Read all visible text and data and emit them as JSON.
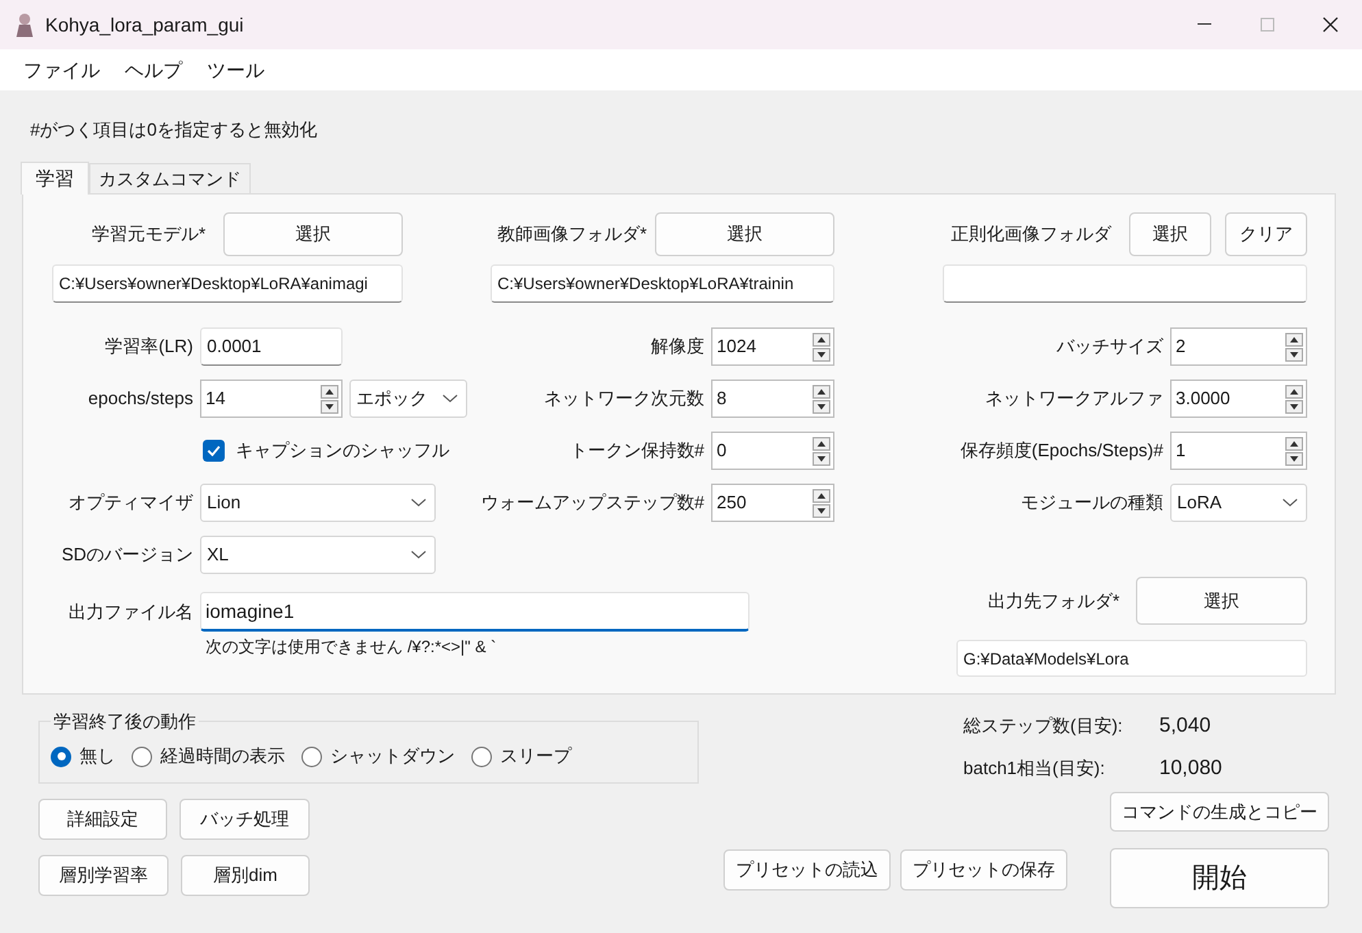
{
  "window": {
    "title": "Kohya_lora_param_gui"
  },
  "menu": [
    "ファイル",
    "ヘルプ",
    "ツール"
  ],
  "note": "#がつく項目は0を指定すると無効化",
  "tabs": [
    {
      "label": "学習",
      "selected": true
    },
    {
      "label": "カスタムコマンド",
      "selected": false
    }
  ],
  "folders": [
    {
      "label": "学習元モデル*",
      "buttons": [
        "選択"
      ],
      "path": "C:¥Users¥owner¥Desktop¥LoRA¥animagi"
    },
    {
      "label": "教師画像フォルダ*",
      "buttons": [
        "選択"
      ],
      "path": "C:¥Users¥owner¥Desktop¥LoRA¥trainin"
    },
    {
      "label": "正則化画像フォルダ",
      "buttons": [
        "選択",
        "クリア"
      ]
    }
  ],
  "rows": [
    {
      "left": {
        "kind": "text",
        "label": "学習率(LR)",
        "value": "0.0001"
      },
      "middle": {
        "kind": "spin",
        "label": "解像度",
        "value": "1024"
      },
      "right": {
        "kind": "spin",
        "label": "バッチサイズ",
        "value": "2"
      }
    },
    {
      "left": {
        "kind": "spin_combo",
        "label": "epochs/steps",
        "value": "14",
        "unit": "エポック"
      },
      "middle": {
        "kind": "spin",
        "label": "ネットワーク次元数",
        "value": "8"
      },
      "right": {
        "kind": "spin",
        "label": "ネットワークアルファ",
        "value": "3.0000"
      }
    },
    {
      "left": {
        "kind": "check",
        "label": "キャプションのシャッフル",
        "checked": true
      },
      "middle": {
        "kind": "spin",
        "label": "トークン保持数#",
        "value": "0"
      },
      "right": {
        "kind": "spin",
        "label": "保存頻度(Epochs/Steps)#",
        "value": "1"
      }
    },
    {
      "left": {
        "kind": "combo",
        "label": "オプティマイザ",
        "value": "Lion"
      },
      "middle": {
        "kind": "spin",
        "label": "ウォームアップステップ数#",
        "value": "250"
      },
      "right": {
        "kind": "combo",
        "label": "モジュールの種類",
        "value": "LoRA"
      }
    },
    {
      "left": {
        "kind": "combo",
        "label": "SDのバージョン",
        "value": "XL"
      }
    }
  ],
  "output": {
    "file_label": "出力ファイル名",
    "file_name": "iomagine1",
    "hint": "次の文字は使用できません /¥?:*<>|\" & `",
    "folder_label": "出力先フォルダ*",
    "folder_button": "選択",
    "folder_path": "G:¥Data¥Models¥Lora"
  },
  "after_training": {
    "title": "学習終了後の動作",
    "options": [
      {
        "label": "無し",
        "selected": true
      },
      {
        "label": "経過時間の表示",
        "selected": false
      },
      {
        "label": "シャットダウン",
        "selected": false
      },
      {
        "label": "スリープ",
        "selected": false
      }
    ]
  },
  "estimates": [
    {
      "label": "総ステップ数(目安):",
      "value": "5,040"
    },
    {
      "label": "batch1相当(目安):",
      "value": "10,080"
    }
  ],
  "tool_buttons": [
    [
      "詳細設定",
      "バッチ処理"
    ],
    [
      "層別学習率",
      "層別dim"
    ]
  ],
  "preset_buttons": [
    "プリセットの読込",
    "プリセットの保存"
  ],
  "command_button": "コマンドの生成とコピー",
  "start_button": "開始"
}
